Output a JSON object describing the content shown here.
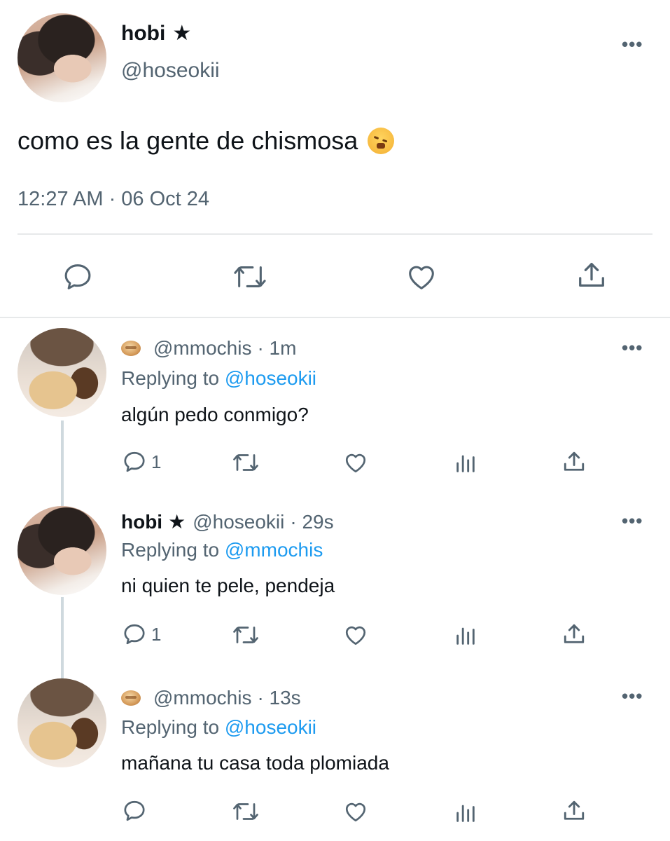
{
  "main_tweet": {
    "display_name": "hobi",
    "star": "★",
    "handle": "@hoseokii",
    "text": "como es la gente de chismosa",
    "emoji": "face-with-steam-from-nose",
    "timestamp": "12:27 AM · 06 Oct 24"
  },
  "replies": [
    {
      "handle": "@mmochis",
      "time": "· 1m",
      "replying_label": "Replying to",
      "replying_to": "@hoseokii",
      "text": "algún pedo conmigo?",
      "reply_count": "1"
    },
    {
      "display_name": "hobi",
      "star": "★",
      "handle": "@hoseokii",
      "time": "· 29s",
      "replying_label": "Replying to",
      "replying_to": "@mmochis",
      "text": "ni quien te pele, pendeja",
      "reply_count": "1"
    },
    {
      "handle": "@mmochis",
      "time": "· 13s",
      "replying_label": "Replying to",
      "replying_to": "@hoseokii",
      "text": "mañana tu casa toda plomiada",
      "reply_count": ""
    }
  ],
  "more_label": "•••",
  "colors": {
    "text": "#0f1419",
    "secondary": "#536471",
    "mention": "#1d9bf0",
    "divider": "#e7e9ea"
  }
}
